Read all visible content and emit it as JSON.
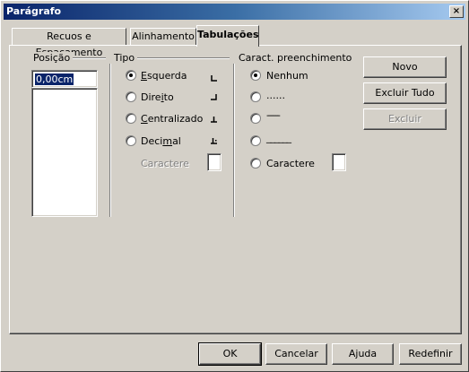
{
  "window": {
    "title": "Parágrafo",
    "close_glyph": "×"
  },
  "tabs": [
    {
      "label": "Recuos e Espaçamento",
      "active": false
    },
    {
      "label": "Alinhamento",
      "active": false
    },
    {
      "label": "Tabulações",
      "active": true
    }
  ],
  "position": {
    "group_label": "Posição",
    "value": "0,00cm",
    "list_items": []
  },
  "type": {
    "group_label": "Tipo",
    "options": [
      {
        "label": "Esquerda",
        "mnemonic": "E",
        "rest": "squerda",
        "checked": true,
        "icon": "tab-left-icon"
      },
      {
        "label": "Direito",
        "mnemonic": "i",
        "pre": "Dire",
        "rest": "to",
        "checked": false,
        "icon": "tab-right-icon"
      },
      {
        "label": "Centralizado",
        "mnemonic": "C",
        "rest": "entralizado",
        "checked": false,
        "icon": "tab-center-icon"
      },
      {
        "label": "Decimal",
        "mnemonic": "m",
        "pre": "Deci",
        "rest": "al",
        "checked": false,
        "icon": "tab-decimal-icon"
      }
    ],
    "character_label": "Caractere",
    "character_value": ""
  },
  "fill": {
    "group_label": "Caract. preenchimento",
    "options": [
      {
        "label": "Nenhum",
        "checked": true
      },
      {
        "label": "......",
        "checked": false
      },
      {
        "label": "-------",
        "checked": false
      },
      {
        "label": "______",
        "checked": false
      },
      {
        "label": "Caractere",
        "checked": false
      }
    ],
    "character_value": ""
  },
  "side_buttons": {
    "new": "Novo",
    "delete_all": "Excluir Tudo",
    "delete": "Excluir"
  },
  "footer_buttons": {
    "ok": "OK",
    "cancel": "Cancelar",
    "help": "Ajuda",
    "reset": "Redefinir"
  }
}
